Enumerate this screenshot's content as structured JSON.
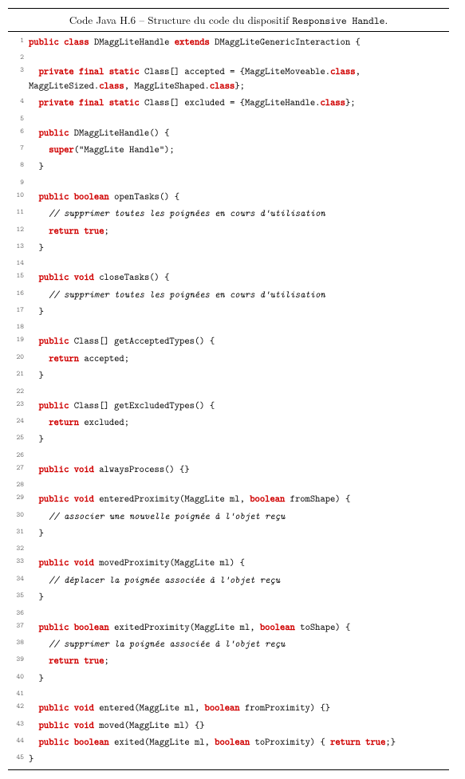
{
  "caption": {
    "prefix": "Code Java H.6 – Structure du code du dispositif ",
    "name": "Responsive Handle",
    "suffix": "."
  },
  "kw": {
    "public": "public",
    "class": "class",
    "extends": "extends",
    "private": "private",
    "final": "final",
    "static": "static",
    "super": "super",
    "boolean": "boolean",
    "return": "return",
    "true": "true",
    "void": "void"
  },
  "c": {
    "decl1": " DMaggLiteHandle ",
    "decl2": " DMaggLiteGenericInteraction {",
    "accepted1": " Class[] accepted = {MaggLiteMoveable.",
    "accepted2": ", MaggLiteSized.",
    "accepted3": ", MaggLiteShaped.",
    "accepted_end": "};",
    "excluded1": " Class[] excluded = {MaggLiteHandle.",
    "excluded_end": "};",
    "ctor_sig": " DMaggLiteHandle() {",
    "ctor_super_arg": "(\"MaggLite Handle\");",
    "brace_close": "}",
    "openTasks_sig": " openTasks() {",
    "openTasks_cm": "// supprimer toutes les poignées en cours d'utilisation",
    "return_sp": " ",
    "semi": ";",
    "closeTasks_sig": " closeTasks() {",
    "closeTasks_cm": "// supprimer toutes les poignées en cours d'utilisation",
    "getAcc_sig": " Class[] getAcceptedTypes() {",
    "getAcc_ret": " accepted;",
    "getExc_sig": " Class[] getExcludedTypes() {",
    "getExc_ret": " excluded;",
    "always_sig": " alwaysProcess() {}",
    "entProx_sig1": " enteredProximity(MaggLite ml, ",
    "entProx_sig2": " fromShape) {",
    "entProx_cm": "// associer une nouvelle poignée à l'objet reçu",
    "movProx_sig": " movedProximity(MaggLite ml) {",
    "movProx_cm": "// déplacer la poignée associée à l'objet reçu",
    "exProx_sig1": " exitedProximity(MaggLite ml, ",
    "exProx_sig2": " toShape) {",
    "exProx_cm": "// supprimer la poignée associée à l'objet reçu",
    "entered_sig1": " entered(MaggLite ml, ",
    "entered_sig2": " fromProximity) {}",
    "moved_sig": " moved(MaggLite ml) {}",
    "exited_sig1": " exited(MaggLite ml, ",
    "exited_sig2": " toProximity) { ",
    "exited_end": ";}",
    "cls": "class"
  },
  "ln": {
    "1": "1",
    "2": "2",
    "3": "3",
    "4": "4",
    "5": "5",
    "6": "6",
    "7": "7",
    "8": "8",
    "9": "9",
    "10": "10",
    "11": "11",
    "12": "12",
    "13": "13",
    "14": "14",
    "15": "15",
    "16": "16",
    "17": "17",
    "18": "18",
    "19": "19",
    "20": "20",
    "21": "21",
    "22": "22",
    "23": "23",
    "24": "24",
    "25": "25",
    "26": "26",
    "27": "27",
    "28": "28",
    "29": "29",
    "30": "30",
    "31": "31",
    "32": "32",
    "33": "33",
    "34": "34",
    "35": "35",
    "36": "36",
    "37": "37",
    "38": "38",
    "39": "39",
    "40": "40",
    "41": "41",
    "42": "42",
    "43": "43",
    "44": "44",
    "45": "45"
  }
}
